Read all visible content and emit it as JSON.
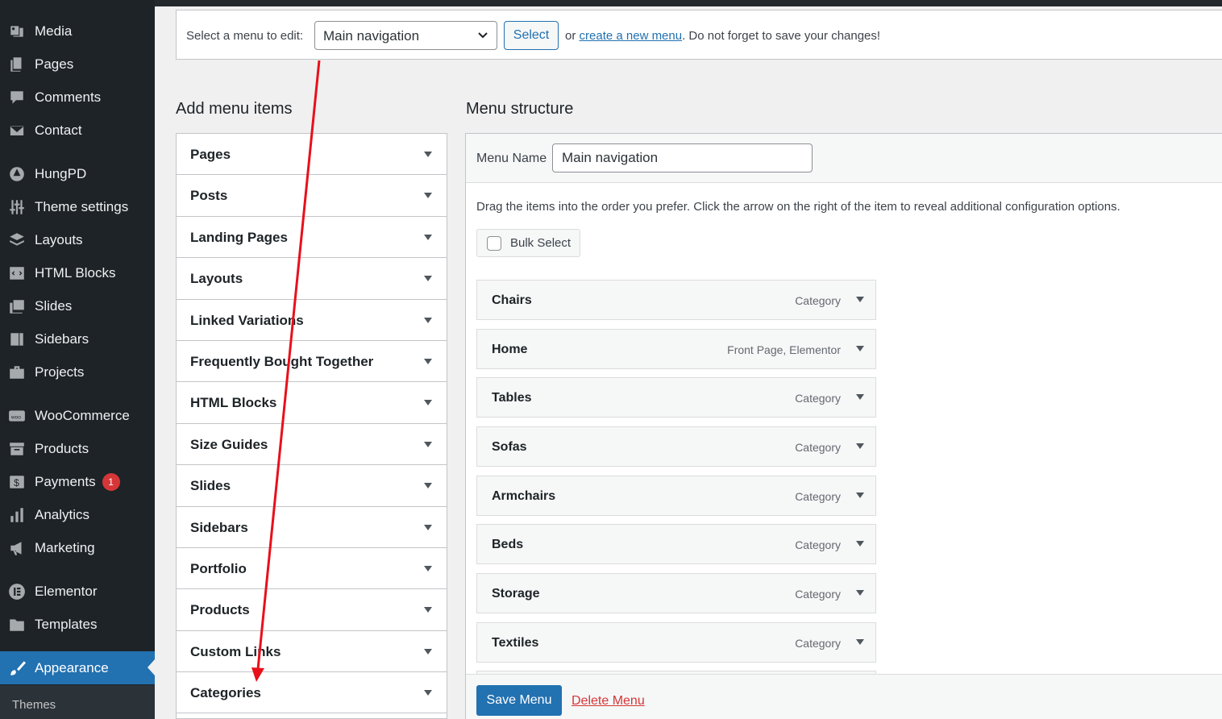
{
  "sidebar": {
    "items": [
      {
        "label": "Media",
        "icon": "media-icon"
      },
      {
        "label": "Pages",
        "icon": "pages-icon"
      },
      {
        "label": "Comments",
        "icon": "comments-icon"
      },
      {
        "label": "Contact",
        "icon": "mail-icon"
      },
      {
        "label": "HungPD",
        "icon": "tree-icon"
      },
      {
        "label": "Theme settings",
        "icon": "sliders-icon"
      },
      {
        "label": "Layouts",
        "icon": "layers-icon"
      },
      {
        "label": "HTML Blocks",
        "icon": "code-block-icon"
      },
      {
        "label": "Slides",
        "icon": "slides-icon"
      },
      {
        "label": "Sidebars",
        "icon": "sidebar-icon"
      },
      {
        "label": "Projects",
        "icon": "briefcase-icon"
      },
      {
        "label": "WooCommerce",
        "icon": "woo-icon"
      },
      {
        "label": "Products",
        "icon": "archive-icon"
      },
      {
        "label": "Payments",
        "icon": "dollar-icon",
        "badge": "1"
      },
      {
        "label": "Analytics",
        "icon": "bar-chart-icon"
      },
      {
        "label": "Marketing",
        "icon": "megaphone-icon"
      },
      {
        "label": "Elementor",
        "icon": "elementor-icon"
      },
      {
        "label": "Templates",
        "icon": "folder-icon"
      },
      {
        "label": "Appearance",
        "icon": "brush-icon"
      }
    ],
    "submenu_label": "Themes"
  },
  "select_bar": {
    "label": "Select a menu to edit:",
    "selected": "Main navigation",
    "button": "Select",
    "or": "or ",
    "create_link": "create a new menu",
    "tail": ". Do not forget to save your changes!"
  },
  "add_items": {
    "heading": "Add menu items",
    "sections": [
      "Pages",
      "Posts",
      "Landing Pages",
      "Layouts",
      "Linked Variations",
      "Frequently Bought Together",
      "HTML Blocks",
      "Size Guides",
      "Slides",
      "Sidebars",
      "Portfolio",
      "Products",
      "Custom Links",
      "Categories"
    ]
  },
  "structure": {
    "heading": "Menu structure",
    "name_label": "Menu Name",
    "name_value": "Main navigation",
    "description": "Drag the items into the order you prefer. Click the arrow on the right of the item to reveal additional configuration options.",
    "bulk_select": "Bulk Select",
    "items": [
      {
        "title": "Chairs",
        "type": "Category"
      },
      {
        "title": "Home",
        "type": "Front Page, Elementor"
      },
      {
        "title": "Tables",
        "type": "Category"
      },
      {
        "title": "Sofas",
        "type": "Category"
      },
      {
        "title": "Armchairs",
        "type": "Category"
      },
      {
        "title": "Beds",
        "type": "Category"
      },
      {
        "title": "Storage",
        "type": "Category"
      },
      {
        "title": "Textiles",
        "type": "Category"
      }
    ],
    "save_button": "Save Menu",
    "delete_link": "Delete Menu"
  },
  "colors": {
    "accent": "#2271b1",
    "annotation_arrow": "#e8101a",
    "sidebar": "#1d2327"
  }
}
